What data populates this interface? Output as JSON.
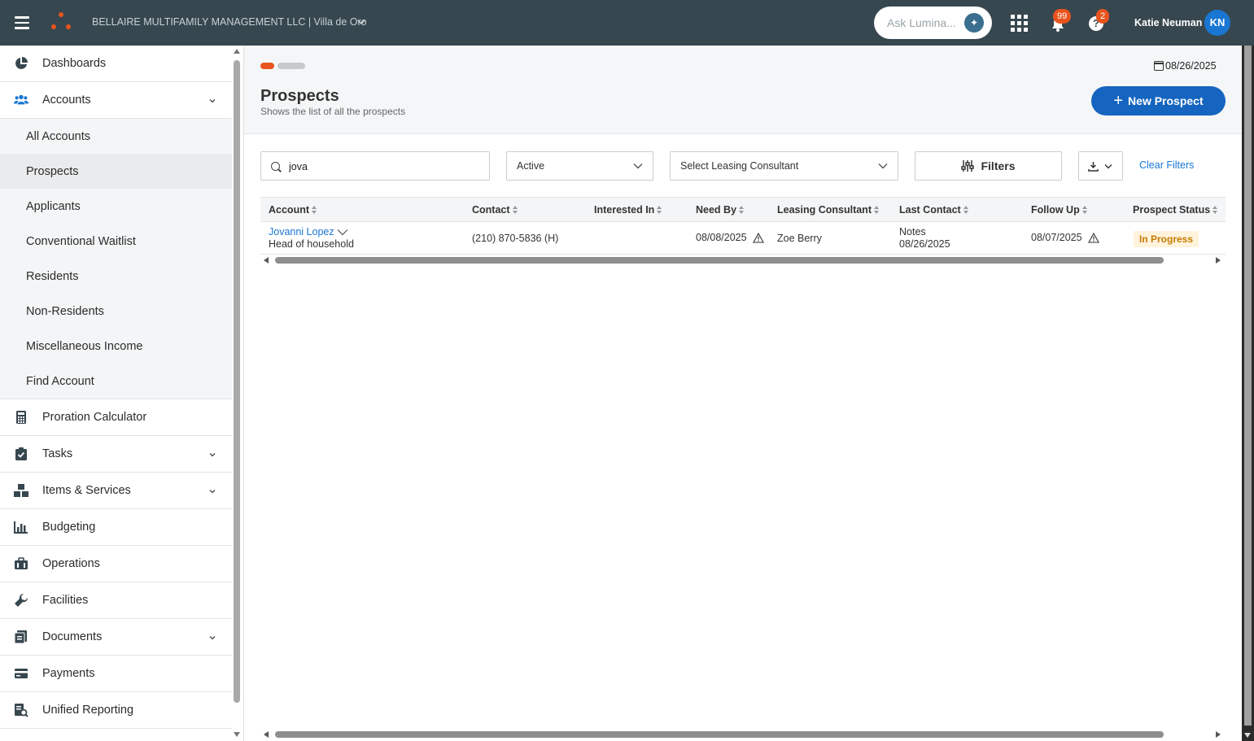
{
  "topbar": {
    "org_label": "BELLAIRE MULTIFAMILY MANAGEMENT LLC | Villa de Oro",
    "ask_placeholder": "Ask Lumina...",
    "notifications_count": "99",
    "help_count": "2",
    "user_name": "Katie Neuman",
    "user_initials": "KN",
    "icons": [
      "menu-icon",
      "logo",
      "chevron-down-icon",
      "sparkle-icon",
      "apps-grid-icon",
      "bell-icon",
      "help-icon"
    ]
  },
  "sidebar": {
    "items": [
      {
        "label": "Dashboards",
        "icon": "pie-chart-icon"
      },
      {
        "label": "Accounts",
        "icon": "users-icon",
        "expanded": true
      },
      {
        "label": "Proration Calculator",
        "icon": "calculator-icon"
      },
      {
        "label": "Tasks",
        "icon": "clipboard-check-icon"
      },
      {
        "label": "Items & Services",
        "icon": "boxes-icon"
      },
      {
        "label": "Budgeting",
        "icon": "bar-chart-icon"
      },
      {
        "label": "Operations",
        "icon": "briefcase-icon"
      },
      {
        "label": "Facilities",
        "icon": "wrench-icon"
      },
      {
        "label": "Documents",
        "icon": "documents-icon"
      },
      {
        "label": "Payments",
        "icon": "credit-card-icon"
      },
      {
        "label": "Unified Reporting",
        "icon": "report-search-icon"
      }
    ],
    "accounts_sub": [
      {
        "label": "All Accounts"
      },
      {
        "label": "Prospects",
        "selected": true
      },
      {
        "label": "Applicants"
      },
      {
        "label": "Conventional Waitlist"
      },
      {
        "label": "Residents"
      },
      {
        "label": "Non-Residents"
      },
      {
        "label": "Miscellaneous Income"
      },
      {
        "label": "Find Account"
      }
    ]
  },
  "page": {
    "date": "08/26/2025",
    "title": "Prospects",
    "subtitle": "Shows the list of all the prospects",
    "new_button": "New Prospect",
    "colors": {
      "accent": "#e8541e",
      "primary": "#1565c0",
      "topbar": "#37474f"
    }
  },
  "filters": {
    "search_value": "jova",
    "status_value": "Active",
    "consultant_value": "Select Leasing Consultant",
    "filters_label": "Filters",
    "clear_label": "Clear Filters"
  },
  "table": {
    "columns": [
      "Account",
      "Contact",
      "Interested In",
      "Need By",
      "Leasing Consultant",
      "Last Contact",
      "Follow Up",
      "Prospect Status"
    ],
    "rows": [
      {
        "account_name": "Jovanni Lopez",
        "account_role": "Head of household",
        "contact": "(210) 870-5836 (H)",
        "interested_in": "",
        "need_by": "08/08/2025",
        "leasing_consultant": "Zoe Berry",
        "last_contact_type": "Notes",
        "last_contact_date": "08/26/2025",
        "follow_up": "08/07/2025",
        "status": "In Progress"
      }
    ]
  }
}
